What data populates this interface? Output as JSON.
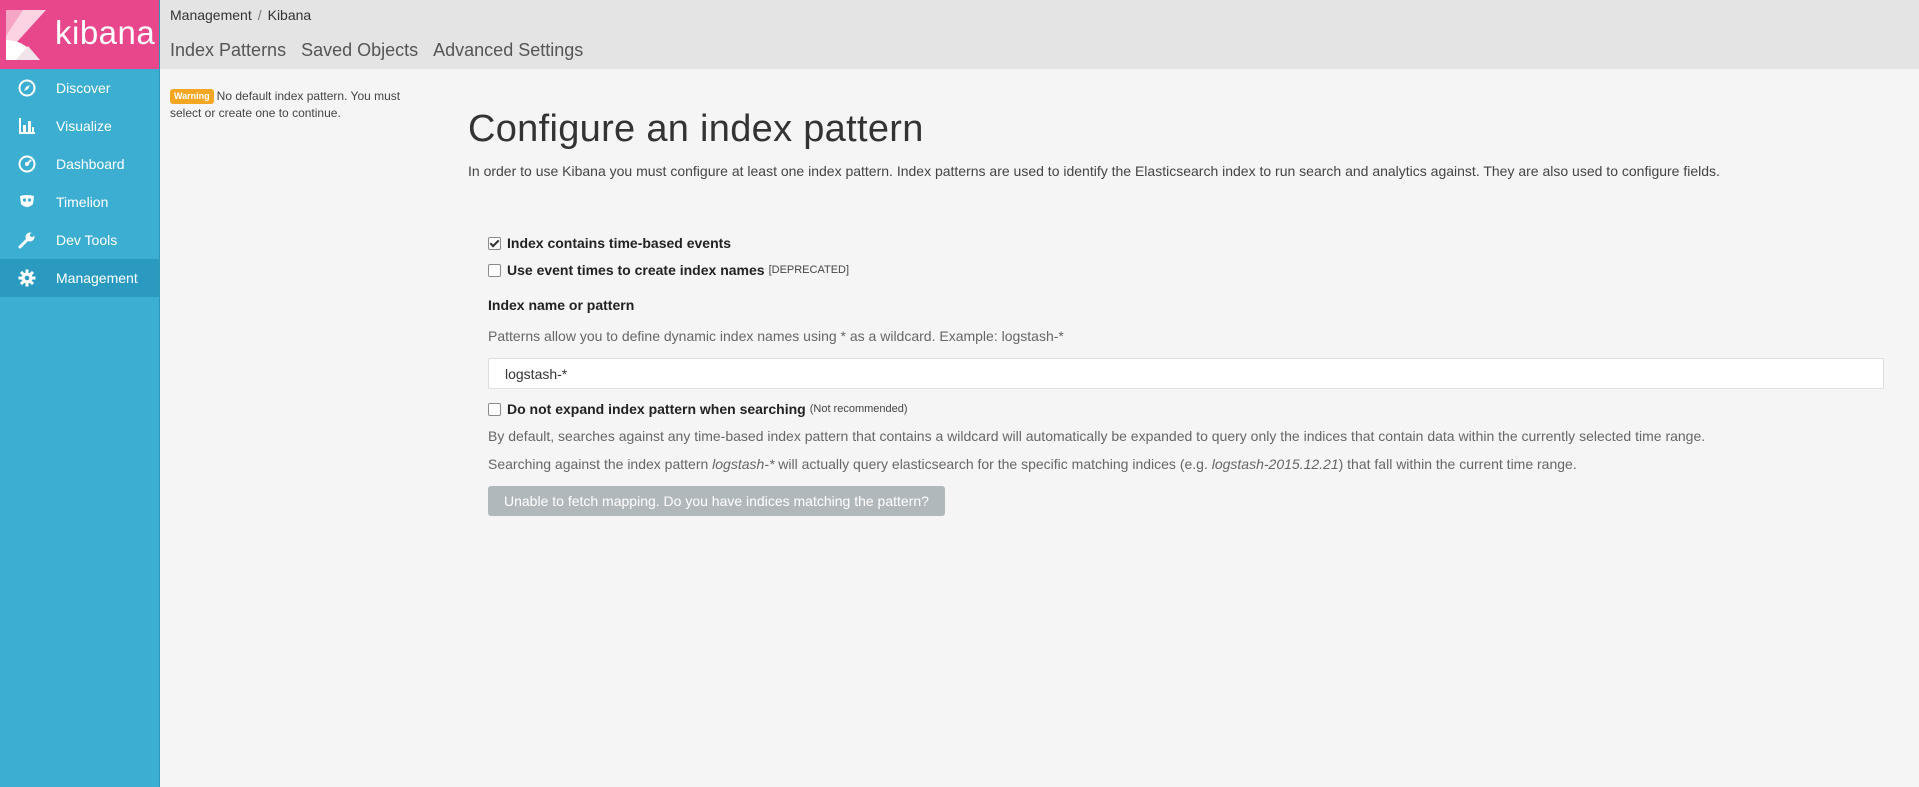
{
  "brand": {
    "name": "kibana"
  },
  "sidebar": {
    "items": [
      {
        "label": "Discover",
        "icon": "compass-icon"
      },
      {
        "label": "Visualize",
        "icon": "bar-chart-icon"
      },
      {
        "label": "Dashboard",
        "icon": "dashboard-gauge-icon"
      },
      {
        "label": "Timelion",
        "icon": "timelion-mask-icon"
      },
      {
        "label": "Dev Tools",
        "icon": "wrench-icon"
      },
      {
        "label": "Management",
        "icon": "gear-icon",
        "active": true
      }
    ]
  },
  "breadcrumb": {
    "parent": "Management",
    "separator": "/",
    "current": "Kibana"
  },
  "tabs": [
    "Index Patterns",
    "Saved Objects",
    "Advanced Settings"
  ],
  "warning": {
    "badge": "Warning",
    "text": "No default index pattern. You must select or create one to continue."
  },
  "main": {
    "title": "Configure an index pattern",
    "intro": "In order to use Kibana you must configure at least one index pattern. Index patterns are used to identify the Elasticsearch index to run search and analytics against. They are also used to configure fields."
  },
  "form": {
    "time_based": {
      "label": "Index contains time-based events",
      "checked": true
    },
    "event_times": {
      "label": "Use event times to create index names",
      "note": "[DEPRECATED]",
      "checked": false
    },
    "index_label": "Index name or pattern",
    "index_help": "Patterns allow you to define dynamic index names using * as a wildcard. Example: logstash-*",
    "index_value": "logstash-*",
    "no_expand": {
      "label": "Do not expand index pattern when searching",
      "note": "(Not recommended)",
      "checked": false
    },
    "expand_desc": "By default, searches against any time-based index pattern that contains a wildcard will automatically be expanded to query only the indices that contain data within the currently selected time range.",
    "search_desc": {
      "p1": "Searching against the index pattern ",
      "em1": "logstash-*",
      "p2": " will actually query elasticsearch for the specific matching indices (e.g. ",
      "em2": "logstash-2015.12.21",
      "p3": ") that fall within the current time range."
    },
    "submit_label": "Unable to fetch mapping. Do you have indices matching the pattern?"
  },
  "colors": {
    "sidebar": "#3caed2",
    "logo": "#e8488b",
    "warning": "#f5a623",
    "button_disabled": "#b1b8bb"
  }
}
